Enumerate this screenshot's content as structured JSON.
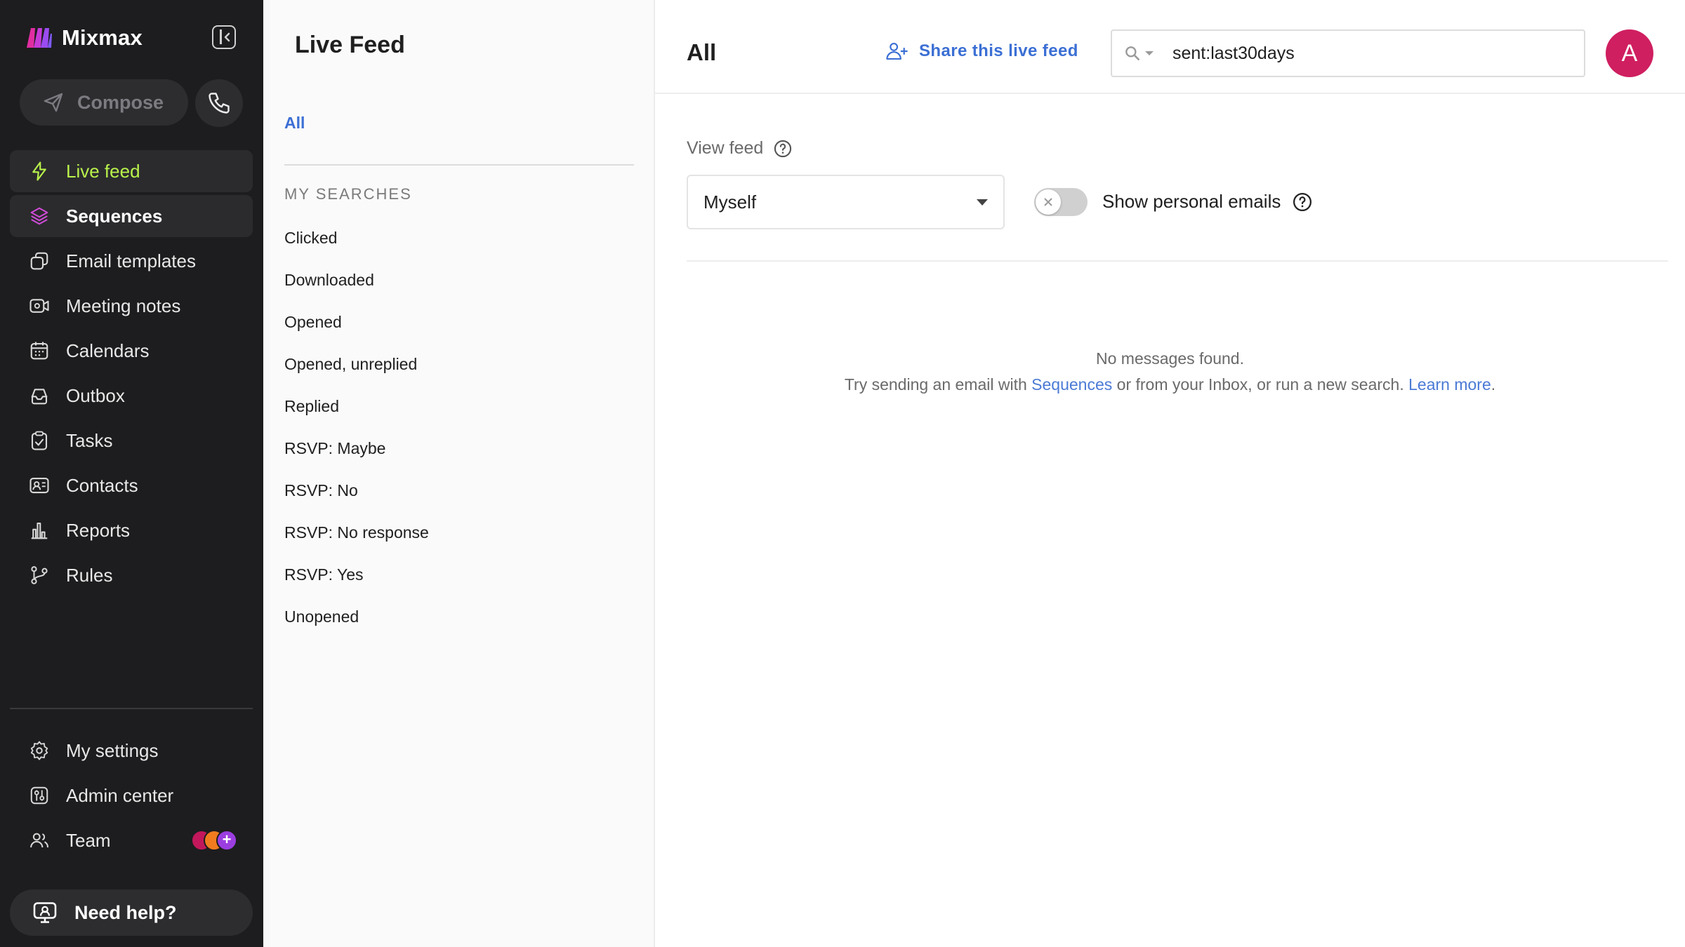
{
  "app": {
    "brand_name": "Mixmax",
    "accent_color": "#b9f24a",
    "brand_color": "#e02ea2"
  },
  "sidebar": {
    "compose_label": "Compose",
    "nav": [
      {
        "label": "Live feed",
        "icon": "bolt-icon",
        "state": "active"
      },
      {
        "label": "Sequences",
        "icon": "layers-icon",
        "state": "hover"
      },
      {
        "label": "Email templates",
        "icon": "templates-icon"
      },
      {
        "label": "Meeting notes",
        "icon": "video-icon"
      },
      {
        "label": "Calendars",
        "icon": "calendar-icon"
      },
      {
        "label": "Outbox",
        "icon": "outbox-icon"
      },
      {
        "label": "Tasks",
        "icon": "tasks-icon"
      },
      {
        "label": "Contacts",
        "icon": "contact-card-icon"
      },
      {
        "label": "Reports",
        "icon": "bar-chart-icon"
      },
      {
        "label": "Rules",
        "icon": "branch-icon"
      }
    ],
    "bottom_nav": [
      {
        "label": "My settings",
        "icon": "gear-icon"
      },
      {
        "label": "Admin center",
        "icon": "admin-icon"
      },
      {
        "label": "Team",
        "icon": "team-icon"
      }
    ],
    "help_label": "Need help?"
  },
  "middle": {
    "title": "Live Feed",
    "all_label": "All",
    "searches_heading": "MY SEARCHES",
    "searches": [
      "Clicked",
      "Downloaded",
      "Opened",
      "Opened, unreplied",
      "Replied",
      "RSVP: Maybe",
      "RSVP: No",
      "RSVP: No response",
      "RSVP: Yes",
      "Unopened"
    ]
  },
  "main": {
    "title": "All",
    "share_label": "Share this live feed",
    "search_value": "sent:last30days",
    "avatar_letter": "A",
    "view_feed_label": "View feed",
    "view_feed_selected": "Myself",
    "personal_toggle_label": "Show personal emails",
    "personal_toggle_on": false,
    "empty_title": "No messages found.",
    "empty_prefix": "Try sending an email with ",
    "empty_link_sequences": "Sequences",
    "empty_middle": " or from your Inbox, or run a new search. ",
    "empty_link_learn": "Learn more",
    "empty_suffix": "."
  }
}
